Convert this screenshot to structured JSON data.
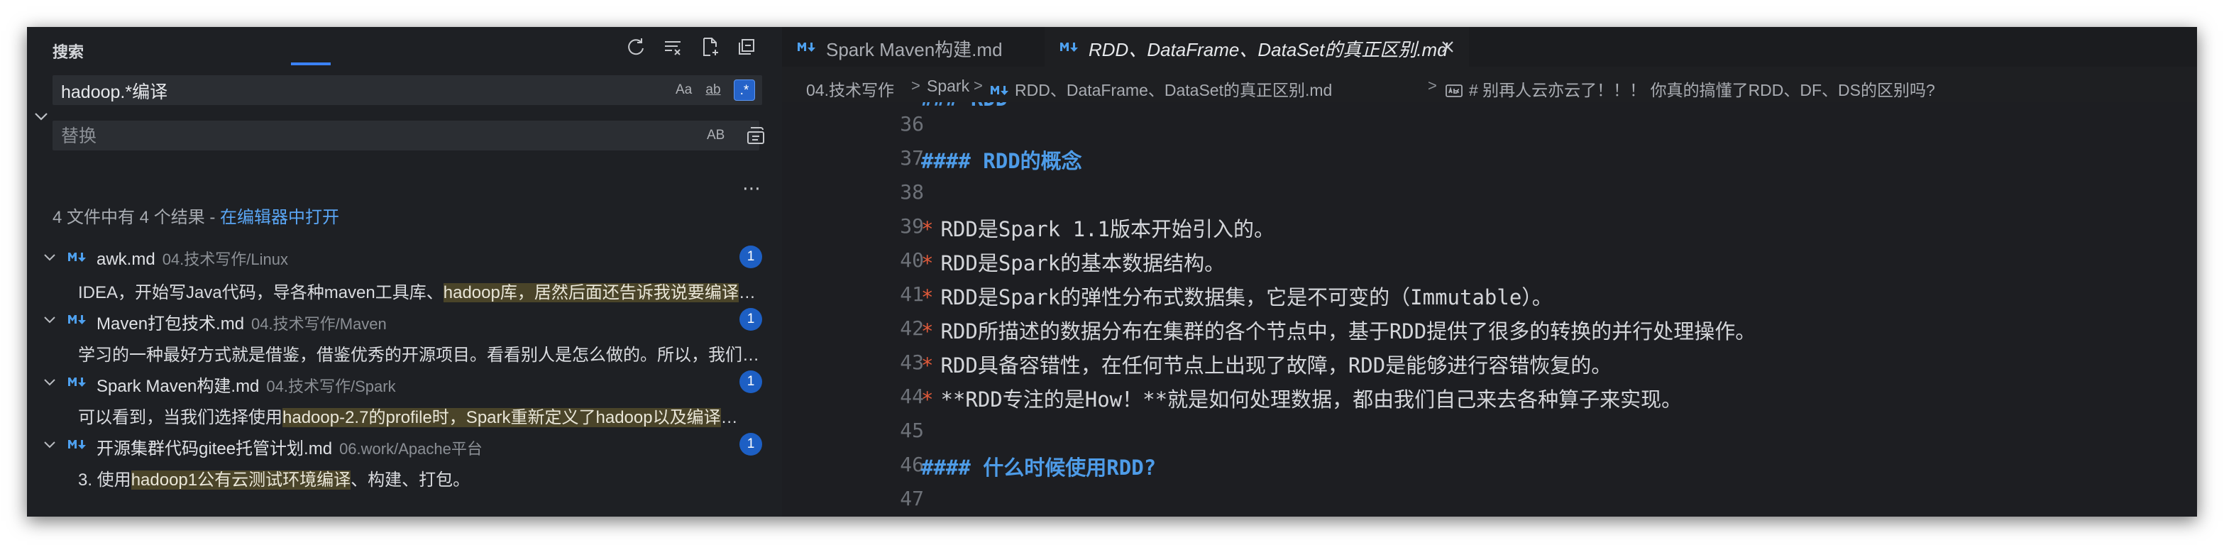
{
  "sidebar": {
    "title": "搜索",
    "search": {
      "value": "hadoop.*编译",
      "options": [
        "Aa",
        "ab",
        ".*"
      ]
    },
    "replace": {
      "placeholder": "替换",
      "option": "AB"
    },
    "summary": {
      "text": "4 文件中有 4 个结果 - ",
      "link": "在编辑器中打开"
    },
    "results": [
      {
        "name": "awk.md",
        "path": "04.技术写作/Linux",
        "count": "1",
        "pre": "IDEA，开始写Java代码，导各种maven工具库、",
        "match": "hadoop库，居然后面还告诉我说要编译",
        "post": "…"
      },
      {
        "name": "Maven打包技术.md",
        "path": "04.技术写作/Maven",
        "count": "1",
        "pre": "学习的一种最好方式就是借鉴，借鉴优秀的开源项目。看看别人是怎么做的。所以，我们来看看",
        "match": "",
        "post": "…"
      },
      {
        "name": "Spark Maven构建.md",
        "path": "04.技术写作/Spark",
        "count": "1",
        "pre": "可以看到，当我们选择使用",
        "match": "hadoop-2.7的profile时，Spark重新定义了hadoop以及编译",
        "post": "…"
      },
      {
        "name": "开源集群代码gitee托管计划.md",
        "path": "06.work/Apache平台",
        "count": "1",
        "pre": "3. 使用",
        "match": "hadoop1公有云测试环境编译",
        "post": "、构建、打包。"
      }
    ]
  },
  "tabs": [
    {
      "label": "Spark Maven构建.md"
    },
    {
      "label": "RDD、DataFrame、DataSet的真正区别.md"
    }
  ],
  "breadcrumb": [
    "04.技术写作",
    "Spark",
    "RDD、DataFrame、DataSet的真正区别.md",
    "# 别再人云亦云了！！！ 你真的搞懂了RDD、DF、DS的区别吗?"
  ],
  "editor": {
    "partial_line": "### RDD",
    "lines": [
      {
        "n": "36",
        "text": ""
      },
      {
        "n": "37",
        "text": "#### RDD的概念",
        "kind": "heading"
      },
      {
        "n": "38",
        "text": ""
      },
      {
        "n": "39",
        "bullet": "*",
        "text": "RDD是Spark 1.1版本开始引入的。"
      },
      {
        "n": "40",
        "bullet": "*",
        "text": "RDD是Spark的基本数据结构。"
      },
      {
        "n": "41",
        "bullet": "*",
        "text": "RDD是Spark的弹性分布式数据集，它是不可变的（Immutable）。"
      },
      {
        "n": "42",
        "bullet": "*",
        "text": "RDD所描述的数据分布在集群的各个节点中，基于RDD提供了很多的转换的并行处理操作。"
      },
      {
        "n": "43",
        "bullet": "*",
        "text": "RDD具备容错性，在任何节点上出现了故障，RDD是能够进行容错恢复的。"
      },
      {
        "n": "44",
        "bullet": "*",
        "text": "**RDD专注的是How！**就是如何处理数据，都由我们自己来去各种算子来实现。"
      },
      {
        "n": "45",
        "text": ""
      },
      {
        "n": "46",
        "text": "#### 什么时候使用RDD?",
        "kind": "heading"
      },
      {
        "n": "47",
        "text": ""
      }
    ]
  },
  "colors": {
    "accent": "#3b82f6",
    "heading": "#4e9ce8",
    "bullet": "#e05a3a",
    "badge": "#1d5fc4"
  }
}
